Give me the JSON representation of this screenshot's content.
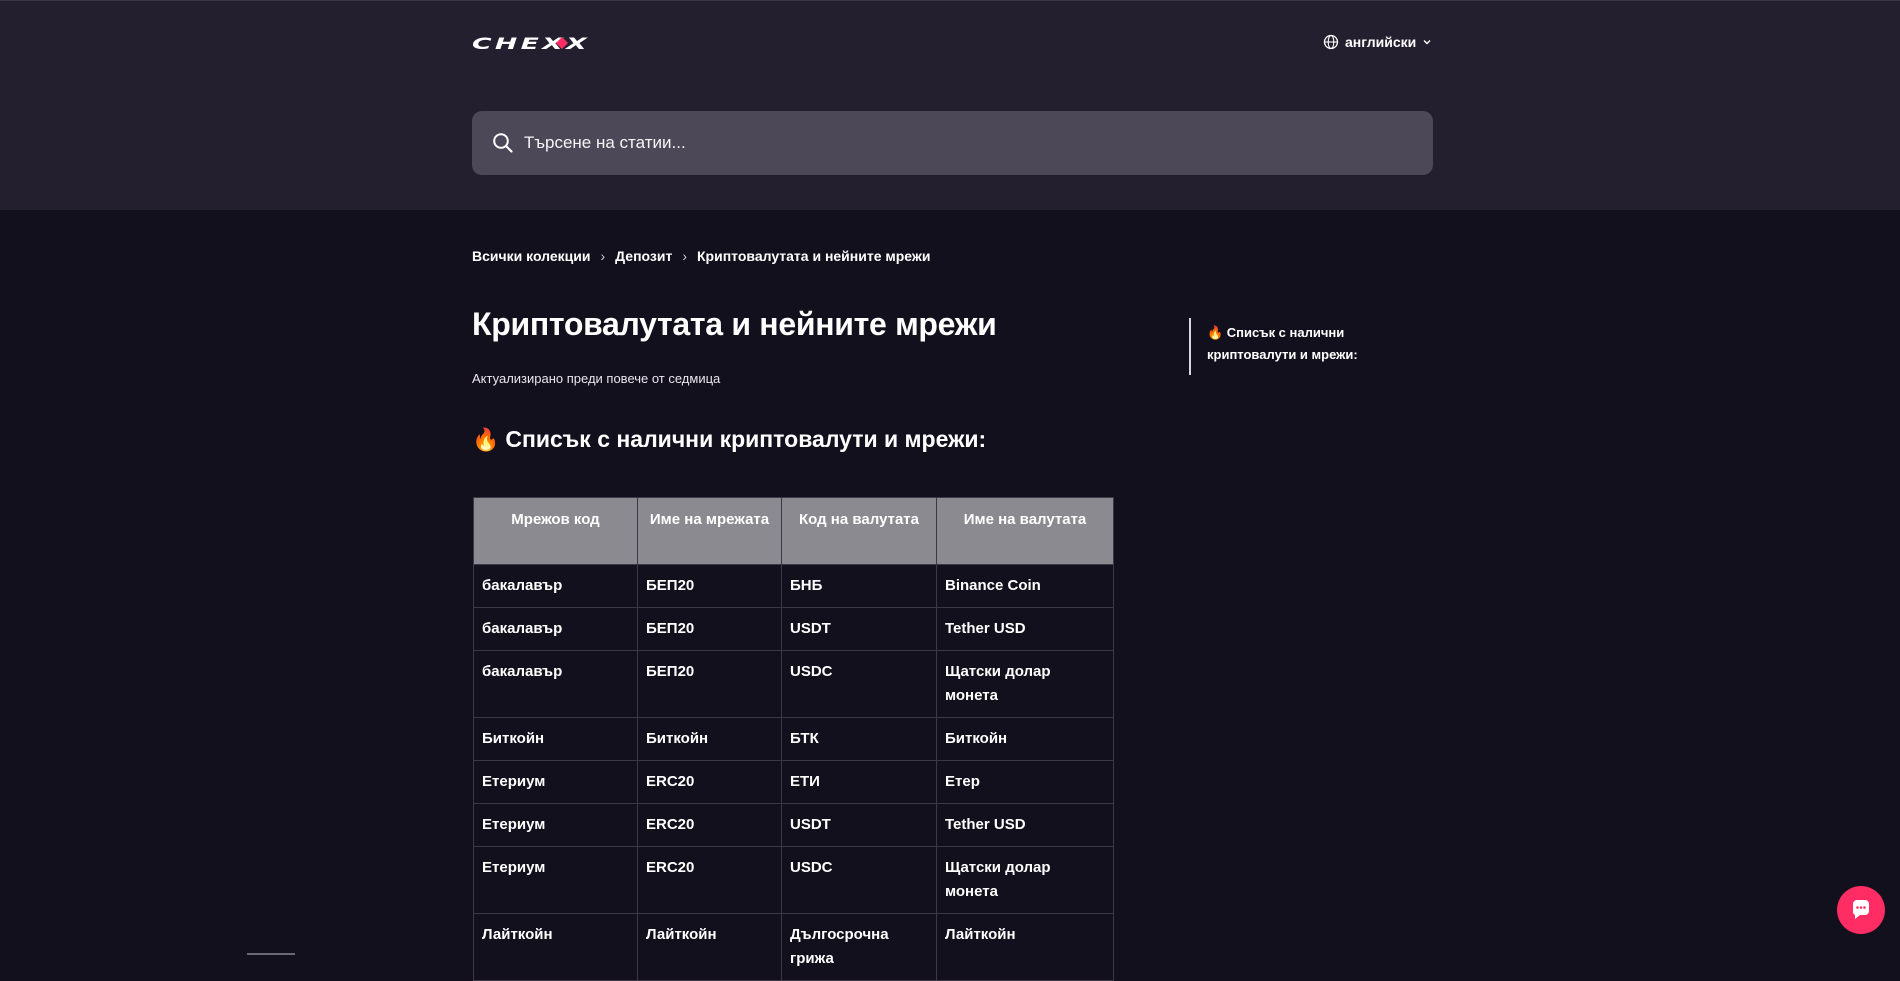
{
  "header": {
    "logo_text": "CHEXX",
    "language_label": "английски",
    "search_placeholder": "Търсене на статии..."
  },
  "breadcrumb": {
    "items": [
      "Всички колекции",
      "Депозит",
      "Криптовалутата и нейните мрежи"
    ]
  },
  "article": {
    "title": "Криптовалутата и нейните мрежи",
    "updated": "Актуализирано преди повече от седмица",
    "section_heading": "Списък с налични криптовалути и мрежи:",
    "section_icon": "fire-emoji"
  },
  "toc": {
    "item": "🔥 Списък с налични криптовалути и мрежи:"
  },
  "table": {
    "headers": [
      "Мрежов код",
      "Име на мрежата",
      "Код на валутата",
      "Име на валутата"
    ],
    "rows": [
      [
        "бакалавър",
        "БЕП20",
        "БНБ",
        "Binance Coin"
      ],
      [
        "бакалавър",
        "БЕП20",
        "USDT",
        "Tether USD"
      ],
      [
        "бакалавър",
        "БЕП20",
        "USDC",
        "Щатски долар монета"
      ],
      [
        "Биткойн",
        "Биткойн",
        "БТК",
        "Биткойн"
      ],
      [
        "Етериум",
        "ERC20",
        "ЕТИ",
        "Етер"
      ],
      [
        "Етериум",
        "ERC20",
        "USDT",
        "Tether USD"
      ],
      [
        "Етериум",
        "ERC20",
        "USDC",
        "Щатски долар монета"
      ],
      [
        "Лайткойн",
        "Лайткойн",
        "Дългосрочна грижа",
        "Лайткойн"
      ]
    ]
  },
  "colors": {
    "header_bg": "#231f2e",
    "page_bg": "#13101d",
    "search_bg": "#4d4857",
    "table_header_bg": "#8b8a90",
    "accent": "#ff2d63"
  }
}
